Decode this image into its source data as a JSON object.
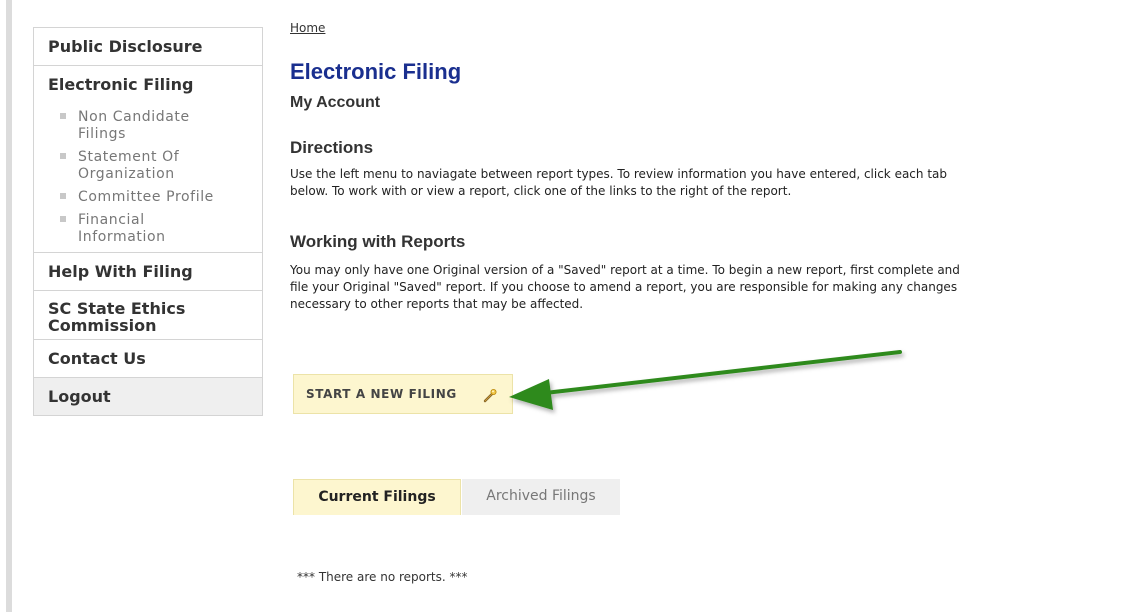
{
  "sidebar": {
    "public_disclosure": "Public Disclosure",
    "electronic_filing": "Electronic Filing",
    "subitems": [
      {
        "line1": "Non Candidate",
        "line2": "Filings"
      },
      {
        "line1": "Statement Of",
        "line2": "Organization"
      },
      {
        "line1": "Committee Profile",
        "line2": ""
      },
      {
        "line1": "Financial",
        "line2": "Information"
      }
    ],
    "help": "Help With Filing",
    "ethics_line1": "SC State Ethics",
    "ethics_line2": "Commission",
    "contact": "Contact Us",
    "logout": "Logout"
  },
  "breadcrumb": "Home",
  "page_title": "Electronic Filing",
  "page_subtitle": "My Account",
  "directions": {
    "heading": "Directions",
    "line1": "Use the left menu to naviagate between report types. To review information you have entered, click each tab",
    "line2": "below. To work with or view a report, click one of the links to the right of the report."
  },
  "working": {
    "heading": "Working with Reports",
    "line1": "You may only have one Original version of a \"Saved\" report at a time. To begin a new report, first complete and",
    "line2": "file your Original \"Saved\" report. If you choose to amend a report, you are responsible for making any changes",
    "line3": "necessary to other reports that may be affected."
  },
  "new_filing_button": "START A NEW FILING",
  "tabs": {
    "current": "Current Filings",
    "archived": "Archived Filings"
  },
  "empty_message": "*** There are no reports. ***",
  "colors": {
    "title_blue": "#1a2f8f",
    "highlight_yellow": "#fdf6cf",
    "arrow_green": "#2f8a1f"
  }
}
